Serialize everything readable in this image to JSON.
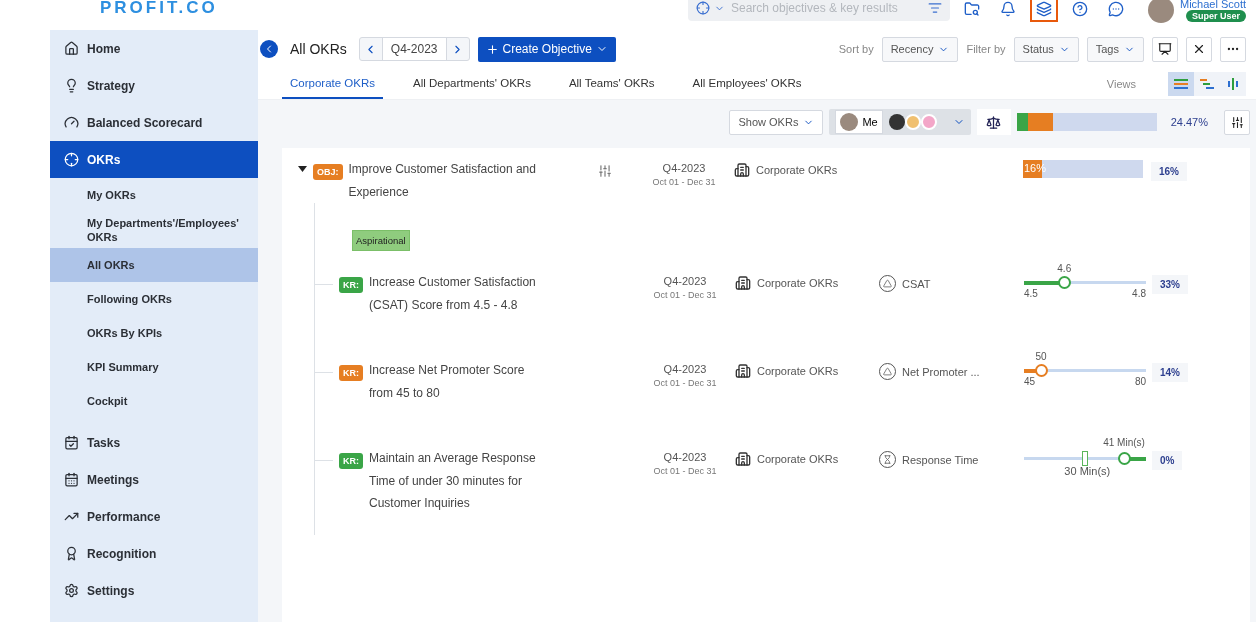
{
  "header": {
    "logo": "PROFIT.CO",
    "search": {
      "placeholder": "Search objectives & key results"
    },
    "icons": [
      {
        "kind": "folder",
        "highlighted": false
      },
      {
        "kind": "bell",
        "highlighted": false
      },
      {
        "kind": "layers",
        "highlighted": true
      },
      {
        "kind": "help",
        "highlighted": false
      },
      {
        "kind": "chat",
        "highlighted": false
      }
    ],
    "user": {
      "name": "Michael Scott",
      "role": "Super User"
    }
  },
  "sidebar": {
    "items": [
      {
        "kind": "home",
        "label": "Home",
        "selected": false
      },
      {
        "kind": "bulb",
        "label": "Strategy",
        "selected": false
      },
      {
        "kind": "gauge",
        "label": "Balanced Scorecard",
        "selected": false
      },
      {
        "kind": "target",
        "label": "OKRs",
        "selected": true,
        "children": [
          {
            "label": "My OKRs",
            "selected": false
          },
          {
            "label": "My Departments'/Employees' OKRs",
            "selected": false
          },
          {
            "label": "All OKRs",
            "selected": true
          },
          {
            "label": "Following OKRs",
            "selected": false
          },
          {
            "label": "OKRs By KPIs",
            "selected": false
          },
          {
            "label": "KPI Summary",
            "selected": false
          },
          {
            "label": "Cockpit",
            "selected": false
          }
        ]
      },
      {
        "kind": "tasks",
        "label": "Tasks",
        "selected": false
      },
      {
        "kind": "calendar",
        "label": "Meetings",
        "selected": false
      },
      {
        "kind": "chart",
        "label": "Performance",
        "selected": false
      },
      {
        "kind": "award",
        "label": "Recognition",
        "selected": false
      },
      {
        "kind": "settings",
        "label": "Settings",
        "selected": false
      }
    ]
  },
  "page": {
    "title": "All OKRs",
    "period": "Q4-2023",
    "create_label": "Create Objective",
    "sort_label": "Sort by",
    "sort_value": "Recency",
    "filter_label": "Filter by",
    "filters": [
      "Status",
      "Tags"
    ]
  },
  "tabs": [
    {
      "label": "Corporate OKRs",
      "selected": true
    },
    {
      "label": "All Departments' OKRs",
      "selected": false
    },
    {
      "label": "All Teams' OKRs",
      "selected": false
    },
    {
      "label": "All Employees' OKRs",
      "selected": false
    }
  ],
  "views": {
    "label": "Views",
    "items": [
      {
        "kind": "list",
        "selected": true
      },
      {
        "kind": "gantt",
        "selected": false
      },
      {
        "kind": "bars",
        "selected": false
      }
    ]
  },
  "toolbar": {
    "show_label": "Show OKRs",
    "me_label": "Me",
    "segments": [
      {
        "color": "#3aa547",
        "level": 0.08
      },
      {
        "color": "#e67e22",
        "level": 0.18
      }
    ],
    "progress_text": "24.47%"
  },
  "objective": {
    "tag": "OBJ:",
    "color": "#e67e22",
    "title": "Improve Customer Satisfaction and Experience",
    "expanded": true,
    "period": "Q4-2023",
    "dates": "Oct 01 - Dec 31",
    "owner": "Corporate OKRs",
    "level": 0.16,
    "bar_label": "16%",
    "percent": "16%",
    "category": "Aspirational",
    "key_results": [
      {
        "tag": "KR:",
        "color": "#3aa547",
        "title": "Increase Customer Satisfaction (CSAT) Score from 4.5 - 4.8",
        "period": "Q4-2023",
        "dates": "Oct 01 - Dec 31",
        "owner": "Corporate OKRs",
        "kpi": {
          "kind": "triangle",
          "label": "CSAT"
        },
        "meter": {
          "kind": "range",
          "level": 0.33,
          "current": "4.6",
          "start": "4.5",
          "end": "4.8"
        },
        "percent": "33%"
      },
      {
        "tag": "KR:",
        "color": "#e67e22",
        "title": "Increase Net Promoter Score from 45 to 80",
        "period": "Q4-2023",
        "dates": "Oct 01 - Dec 31",
        "owner": "Corporate OKRs",
        "kpi": {
          "kind": "triangle",
          "label": "Net Promoter ..."
        },
        "meter": {
          "kind": "range",
          "level": 0.14,
          "current": "50",
          "start": "45",
          "end": "80"
        },
        "percent": "14%"
      },
      {
        "tag": "KR:",
        "color": "#3aa547",
        "title": "Maintain an Average Response Time of under 30 minutes for Customer Inquiries",
        "period": "Q4-2023",
        "dates": "Oct 01 - Dec 31",
        "owner": "Corporate OKRs",
        "kpi": {
          "kind": "hourglass",
          "label": "Response Time"
        },
        "meter": {
          "kind": "target",
          "level": 0.82,
          "current": "41 Min(s)",
          "target": "30 Min(s)"
        },
        "percent": "0%"
      }
    ]
  }
}
